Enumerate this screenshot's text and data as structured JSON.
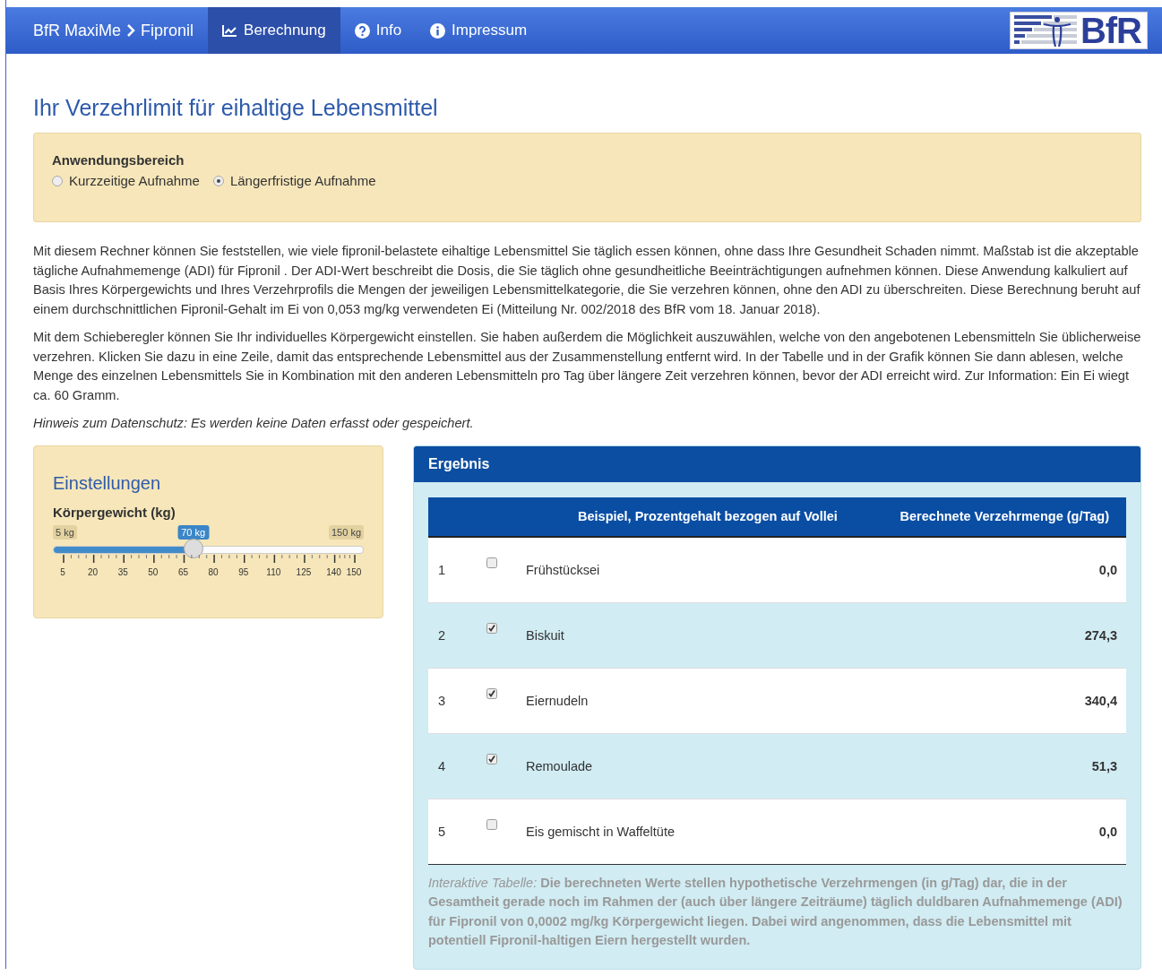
{
  "nav": {
    "brand": "BfR MaxiMe",
    "brand_sub": "Fipronil",
    "tabs": [
      {
        "label": "Berechnung",
        "selected": true
      },
      {
        "label": "Info",
        "selected": false
      },
      {
        "label": "Impressum",
        "selected": false
      }
    ],
    "logo": "BfR"
  },
  "title": "Ihr Verzehrlimit für eihaltige Lebensmittel",
  "scope": {
    "label": "Anwendungsbereich",
    "options": [
      {
        "label": "Kurzzeitige Aufnahme",
        "selected": false
      },
      {
        "label": "Längerfristige Aufnahme",
        "selected": true
      }
    ]
  },
  "paragraphs": [
    "Mit diesem Rechner können Sie feststellen, wie viele fipronil-belastete eihaltige Lebensmittel Sie täglich essen können, ohne dass Ihre Gesundheit Schaden nimmt. Maßstab ist die akzeptable tägliche Aufnahmemenge (ADI) für Fipronil . Der ADI-Wert beschreibt die Dosis, die Sie täglich ohne gesundheitliche Beeinträchtigungen aufnehmen können. Diese Anwendung kalkuliert auf Basis Ihres Körpergewichts und Ihres Verzehrprofils die Mengen der jeweiligen Lebensmittelkategorie, die Sie verzehren können, ohne den ADI zu überschreiten. Diese Berechnung beruht auf einem durchschnittlichen Fipronil-Gehalt im Ei von 0,053 mg/kg verwendeten Ei (Mitteilung Nr. 002/2018 des BfR vom 18. Januar 2018).",
    "Mit dem Schieberegler können Sie Ihr individuelles Körpergewicht einstellen. Sie haben außerdem die Möglichkeit auszuwählen, welche von den angebotenen Lebensmitteln Sie üblicherweise verzehren. Klicken Sie dazu in eine Zeile, damit das entsprechende Lebensmittel aus der Zusammenstellung entfernt wird. In der Tabelle und in der Grafik können Sie dann ablesen, welche Menge des einzelnen Lebensmittels Sie in Kombination mit den anderen Lebensmitteln pro Tag über längere Zeit verzehren können, bevor der ADI erreicht wird. Zur Information: Ein Ei wiegt ca. 60 Gramm."
  ],
  "privacy_note": "Hinweis zum Datenschutz: Es werden keine Daten erfasst oder gespeichert.",
  "settings": {
    "title": "Einstellungen",
    "slider": {
      "label": "Körpergewicht (kg)",
      "min_label": "5 kg",
      "max_label": "150 kg",
      "value_label": "70 kg",
      "level": 0.448,
      "ticks": [
        "5",
        "20",
        "35",
        "50",
        "65",
        "80",
        "95",
        "110",
        "125",
        "140",
        "150"
      ]
    }
  },
  "result": {
    "title": "Ergebnis",
    "columns": [
      "Beispiel, Prozentgehalt bezogen auf Vollei",
      "Berechnete Verzehrmenge (g/Tag)"
    ],
    "rows": [
      {
        "index": "1",
        "checked": false,
        "food": "Frühstücksei",
        "amount": "0,0"
      },
      {
        "index": "2",
        "checked": true,
        "food": "Biskuit",
        "amount": "274,3"
      },
      {
        "index": "3",
        "checked": true,
        "food": "Eiernudeln",
        "amount": "340,4"
      },
      {
        "index": "4",
        "checked": true,
        "food": "Remoulade",
        "amount": "51,3"
      },
      {
        "index": "5",
        "checked": false,
        "food": "Eis gemischt in Waffeltüte",
        "amount": "0,0"
      }
    ],
    "footnote": "*Interaktive Tabelle:* **Die berechneten Werte stellen hypothetische Verzehrmengen (in g/Tag) dar, die in der Gesamtheit gerade noch im Rahmen der (auch über längere Zeiträume) täglich duldbaren Aufnahmemenge (ADI) für Fipronil von 0,0002 mg/kg Körpergewicht liegen. Dabei wird angenommen, dass die Lebensmittel mit potentiell Fipronil-haltigen Eiern hergestellt wurden.**"
  }
}
